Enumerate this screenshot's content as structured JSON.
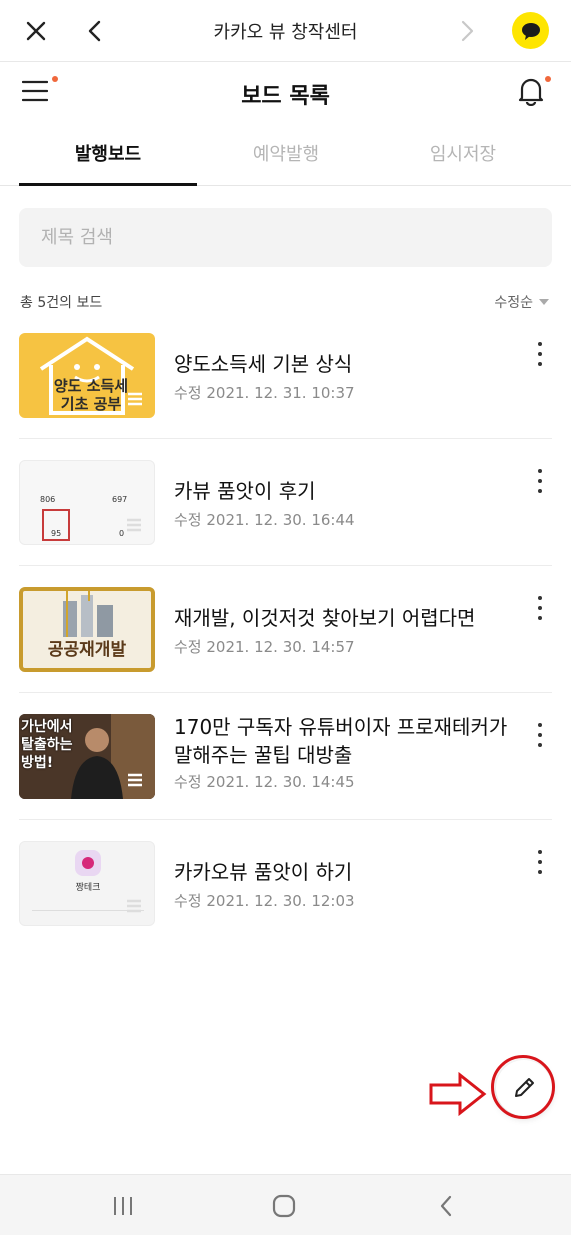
{
  "topbar": {
    "title": "카카오 뷰 창작센터"
  },
  "header": {
    "title": "보드 목록"
  },
  "tabs": [
    {
      "label": "발행보드"
    },
    {
      "label": "예약발행"
    },
    {
      "label": "임시저장"
    }
  ],
  "search": {
    "placeholder": "제목 검색"
  },
  "list_meta": {
    "count": "총 5건의 보드",
    "sort": "수정순"
  },
  "boards": [
    {
      "title": "양도소득세 기본 상식",
      "date": "수정 2021. 12. 31. 10:37",
      "thumb_text": [
        "양도 소득세",
        "기초 공부"
      ]
    },
    {
      "title": "카뷰 품앗이 후기",
      "date": "수정 2021. 12. 30. 16:44",
      "thumb_text": [
        "806",
        "697",
        "95",
        "0"
      ]
    },
    {
      "title": "재개발, 이것저것 찾아보기 어렵다면",
      "date": "수정 2021. 12. 30. 14:57",
      "thumb_text": [
        "공공재개발"
      ]
    },
    {
      "title": "170만 구독자 유튜버이자 프로재테커가 말해주는 꿀팁 대방출",
      "date": "수정 2021. 12. 30. 14:45",
      "thumb_text": [
        "가난에서",
        "탈출하는",
        "방법!"
      ]
    },
    {
      "title": "카카오뷰 품앗이 하기",
      "date": "수정 2021. 12. 30. 12:03",
      "thumb_text": [
        "짱테크"
      ]
    }
  ],
  "colors": {
    "accent": "#fee500",
    "notify_dot": "#f0683c",
    "annotation": "#d8151b"
  }
}
